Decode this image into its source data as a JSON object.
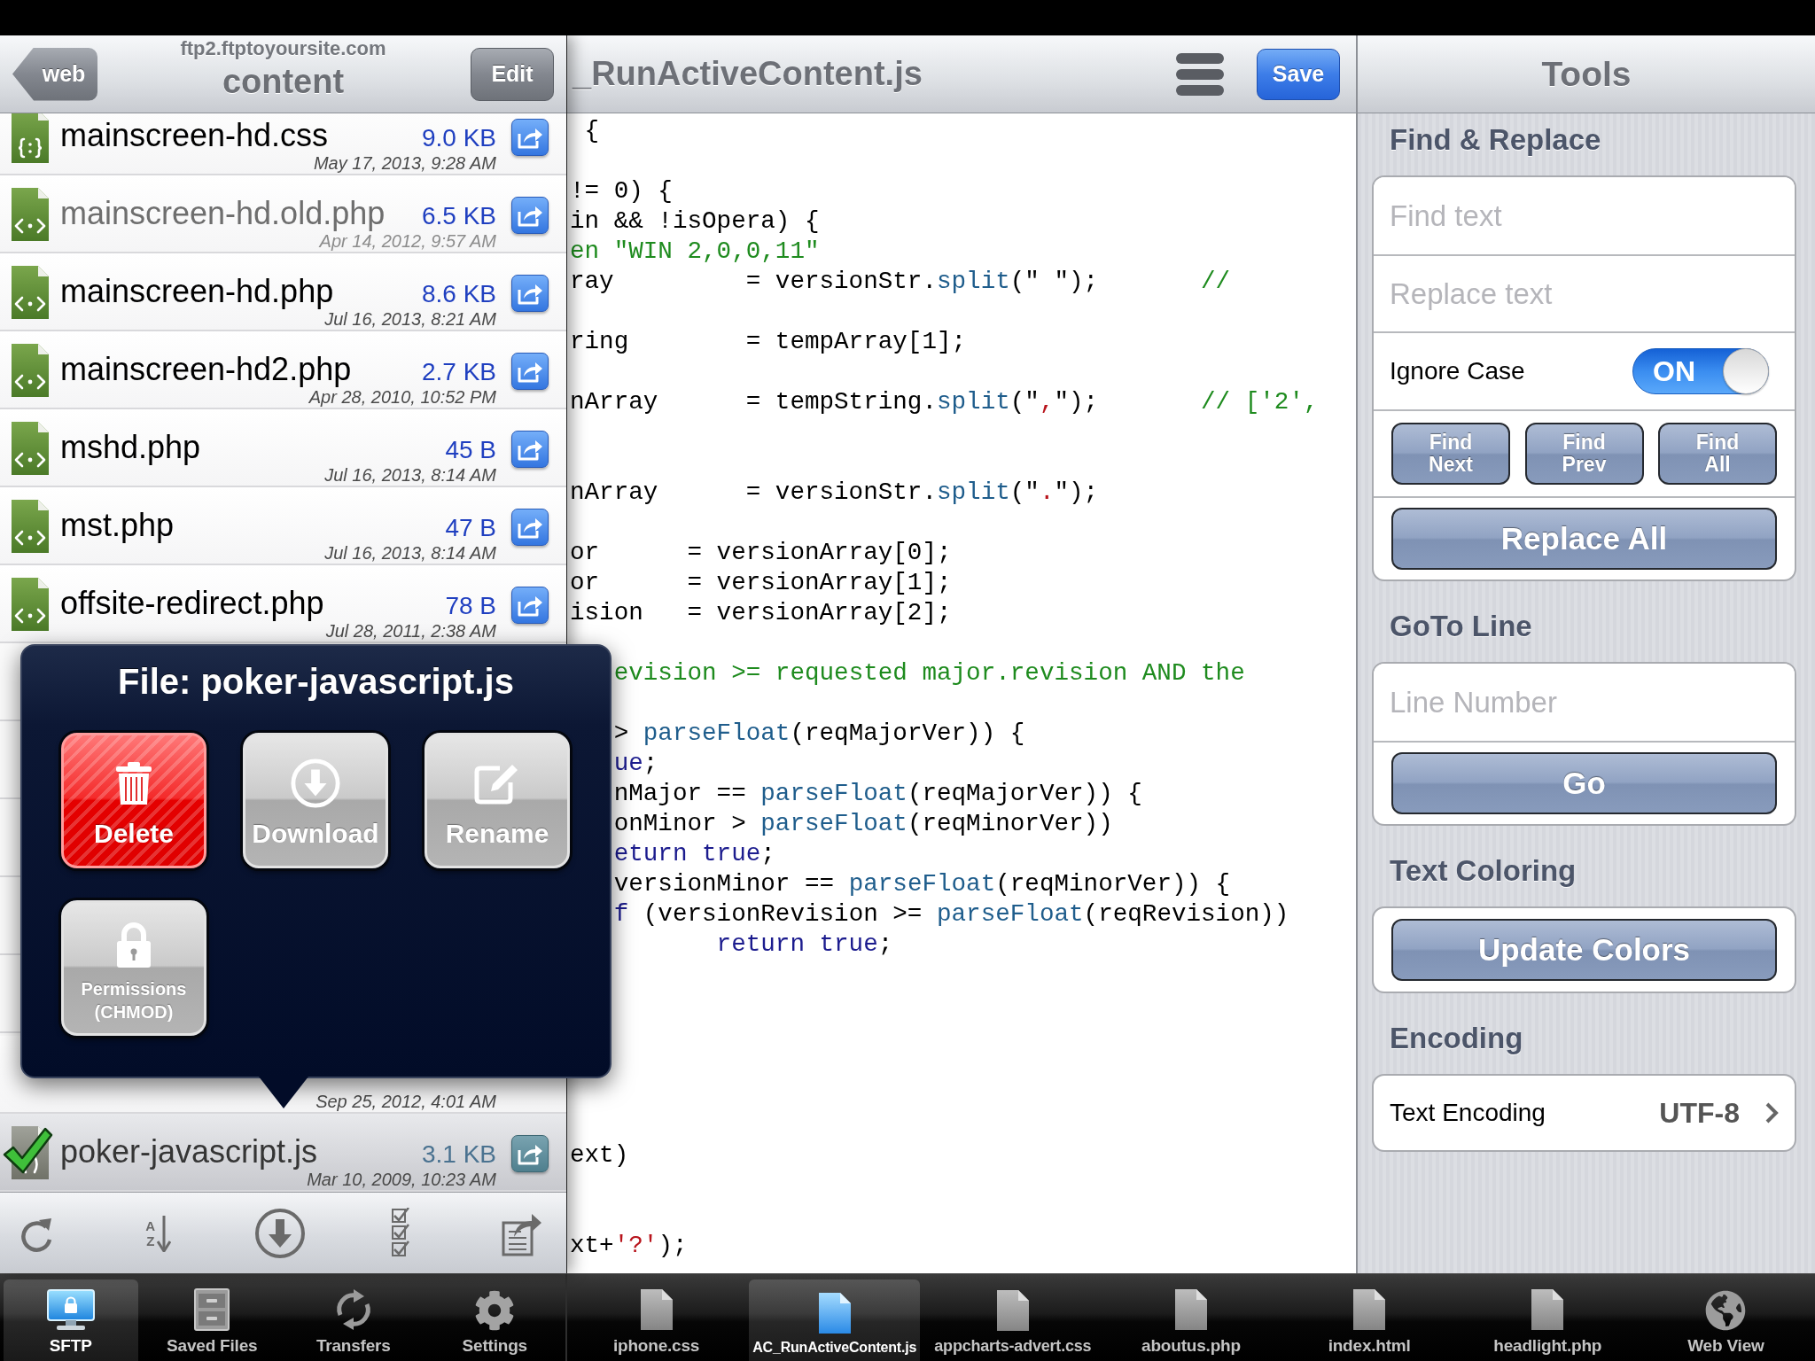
{
  "file_browser": {
    "back_button": "web",
    "host": "ftp2.ftptoyoursite.com",
    "title": "content",
    "edit_button": "Edit",
    "files": [
      {
        "name": "mainscreen-hd.css",
        "size": "9.0 KB",
        "date": "May 17, 2013, 9:28 AM",
        "kind": "css",
        "dimmed": false,
        "selected": false
      },
      {
        "name": "mainscreen-hd.old.php",
        "size": "6.5 KB",
        "date": "Apr 14, 2012, 9:57 AM",
        "kind": "php",
        "dimmed": true,
        "selected": false
      },
      {
        "name": "mainscreen-hd.php",
        "size": "8.6 KB",
        "date": "Jul 16, 2013, 8:21 AM",
        "kind": "php",
        "dimmed": false,
        "selected": false
      },
      {
        "name": "mainscreen-hd2.php",
        "size": "2.7 KB",
        "date": "Apr 28, 2010, 10:52 PM",
        "kind": "php",
        "dimmed": false,
        "selected": false
      },
      {
        "name": "mshd.php",
        "size": "45 B",
        "date": "Jul 16, 2013, 8:14 AM",
        "kind": "php",
        "dimmed": false,
        "selected": false
      },
      {
        "name": "mst.php",
        "size": "47 B",
        "date": "Jul 16, 2013, 8:14 AM",
        "kind": "php",
        "dimmed": false,
        "selected": false
      },
      {
        "name": "offsite-redirect.php",
        "size": "78 B",
        "date": "Jul 28, 2011, 2:38 AM",
        "kind": "php",
        "dimmed": false,
        "selected": false
      }
    ],
    "files_below_popover": [
      {
        "date": "Sep 25, 2012, 4:01 AM",
        "dimmed": false,
        "selected": false
      },
      {
        "name": "poker-javascript.js",
        "size": "3.1 KB",
        "date": "Mar 10, 2009, 10:23 AM",
        "kind": "js",
        "dimmed": false,
        "selected": true
      }
    ],
    "toolbar": [
      {
        "kind": "refresh"
      },
      {
        "kind": "sort",
        "glyphs": [
          "A",
          "Z"
        ]
      },
      {
        "kind": "download"
      },
      {
        "kind": "checklist"
      },
      {
        "kind": "export"
      }
    ]
  },
  "popover": {
    "title": "File: poker-javascript.js",
    "actions": [
      {
        "label": "Delete",
        "kind": "delete"
      },
      {
        "label": "Download",
        "kind": "download"
      },
      {
        "label": "Rename",
        "kind": "rename"
      },
      {
        "label": "Permissions (CHMOD)",
        "kind": "permissions"
      }
    ]
  },
  "editor": {
    "title": "_RunActiveContent.js",
    "save_button": "Save",
    "lines": [
      {
        "kind": "code",
        "segments": [
          {
            "text": " {",
            "kind": "plain"
          }
        ]
      },
      {
        "kind": "blank"
      },
      {
        "kind": "code",
        "segments": [
          {
            "text": "!= 0) {",
            "kind": "plain"
          }
        ]
      },
      {
        "kind": "code",
        "segments": [
          {
            "text": "in && !isOpera) {",
            "kind": "plain"
          }
        ]
      },
      {
        "kind": "code",
        "segments": [
          {
            "text": "en \"WIN 2,0,0,11\"",
            "kind": "comment"
          }
        ]
      },
      {
        "kind": "code",
        "segments": [
          {
            "text": "ray         = versionStr.",
            "kind": "plain"
          },
          {
            "text": "split",
            "kind": "function"
          },
          {
            "text": "(\" \");       ",
            "kind": "plain"
          },
          {
            "text": "//",
            "kind": "comment"
          }
        ]
      },
      {
        "kind": "blank"
      },
      {
        "kind": "code",
        "segments": [
          {
            "text": "ring        = tempArray[1];",
            "kind": "plain"
          }
        ]
      },
      {
        "kind": "blank"
      },
      {
        "kind": "code",
        "segments": [
          {
            "text": "nArray      = tempString.",
            "kind": "plain"
          },
          {
            "text": "split",
            "kind": "function"
          },
          {
            "text": "(\"",
            "kind": "plain"
          },
          {
            "text": ",",
            "kind": "string"
          },
          {
            "text": "\");       ",
            "kind": "plain"
          },
          {
            "text": "// ['2',",
            "kind": "comment"
          }
        ]
      },
      {
        "kind": "blank"
      },
      {
        "kind": "blank"
      },
      {
        "kind": "code",
        "segments": [
          {
            "text": "nArray      = versionStr.",
            "kind": "plain"
          },
          {
            "text": "split",
            "kind": "function"
          },
          {
            "text": "(\"",
            "kind": "plain"
          },
          {
            "text": ".",
            "kind": "string"
          },
          {
            "text": "\");",
            "kind": "plain"
          }
        ]
      },
      {
        "kind": "blank"
      },
      {
        "kind": "code",
        "segments": [
          {
            "text": "or      = versionArray[0];",
            "kind": "plain"
          }
        ]
      },
      {
        "kind": "code",
        "segments": [
          {
            "text": "or      = versionArray[1];",
            "kind": "plain"
          }
        ]
      },
      {
        "kind": "code",
        "segments": [
          {
            "text": "ision   = versionArray[2];",
            "kind": "plain"
          }
        ]
      },
      {
        "kind": "blank"
      },
      {
        "kind": "code",
        "segments": [
          {
            "text": "   evision >= requested major.revision AND the",
            "kind": "comment"
          }
        ]
      },
      {
        "kind": "blank"
      },
      {
        "kind": "code",
        "segments": [
          {
            "text": "   > ",
            "kind": "plain"
          },
          {
            "text": "parseFloat",
            "kind": "function"
          },
          {
            "text": "(reqMajorVer)) {",
            "kind": "plain"
          }
        ]
      },
      {
        "kind": "code",
        "segments": [
          {
            "text": "   ue",
            "kind": "keyword"
          },
          {
            "text": ";",
            "kind": "plain"
          }
        ]
      },
      {
        "kind": "code",
        "segments": [
          {
            "text": "   nMajor == ",
            "kind": "plain"
          },
          {
            "text": "parseFloat",
            "kind": "function"
          },
          {
            "text": "(reqMajorVer)) {",
            "kind": "plain"
          }
        ]
      },
      {
        "kind": "code",
        "segments": [
          {
            "text": "   onMinor > ",
            "kind": "plain"
          },
          {
            "text": "parseFloat",
            "kind": "function"
          },
          {
            "text": "(reqMinorVer))",
            "kind": "plain"
          }
        ]
      },
      {
        "kind": "code",
        "segments": [
          {
            "text": "   eturn true",
            "kind": "keyword"
          },
          {
            "text": ";",
            "kind": "plain"
          }
        ]
      },
      {
        "kind": "code",
        "segments": [
          {
            "text": "   versionMinor == ",
            "kind": "plain"
          },
          {
            "text": "parseFloat",
            "kind": "function"
          },
          {
            "text": "(reqMinorVer)) {",
            "kind": "plain"
          }
        ]
      },
      {
        "kind": "code",
        "segments": [
          {
            "text": "   f",
            "kind": "keyword"
          },
          {
            "text": " (versionRevision >= ",
            "kind": "plain"
          },
          {
            "text": "parseFloat",
            "kind": "function"
          },
          {
            "text": "(reqRevision))",
            "kind": "plain"
          }
        ]
      },
      {
        "kind": "code",
        "segments": [
          {
            "text": "          return true",
            "kind": "keyword"
          },
          {
            "text": ";",
            "kind": "plain"
          }
        ]
      },
      {
        "kind": "blank"
      },
      {
        "kind": "blank"
      },
      {
        "kind": "blank"
      },
      {
        "kind": "blank"
      },
      {
        "kind": "blank"
      },
      {
        "kind": "blank"
      },
      {
        "kind": "code",
        "segments": [
          {
            "text": "ext)",
            "kind": "plain"
          }
        ]
      },
      {
        "kind": "blank"
      },
      {
        "kind": "blank"
      },
      {
        "kind": "code",
        "segments": [
          {
            "text": "xt+",
            "kind": "plain"
          },
          {
            "text": "'?'",
            "kind": "string"
          },
          {
            "text": ");",
            "kind": "plain"
          }
        ]
      }
    ]
  },
  "tools": {
    "title": "Tools",
    "sections": [
      {
        "heading": "Find & Replace",
        "rows": [
          {
            "kind": "field",
            "placeholder": "Find text"
          },
          {
            "kind": "field",
            "placeholder": "Replace text"
          },
          {
            "kind": "switch",
            "label": "Ignore Case",
            "on": true,
            "state_text": "ON"
          },
          {
            "kind": "buttons",
            "buttons": [
              "Find Next",
              "Find Prev",
              "Find All"
            ]
          },
          {
            "kind": "button",
            "label": "Replace All"
          }
        ]
      },
      {
        "heading": "GoTo Line",
        "rows": [
          {
            "kind": "field",
            "placeholder": "Line Number"
          },
          {
            "kind": "button",
            "label": "Go"
          }
        ]
      },
      {
        "heading": "Text Coloring",
        "rows": [
          {
            "kind": "button",
            "label": "Update Colors"
          }
        ]
      },
      {
        "heading": "Encoding",
        "rows": [
          {
            "kind": "disclosure",
            "label": "Text Encoding",
            "value": "UTF-8"
          }
        ]
      }
    ]
  },
  "tab_bar": {
    "sections": [
      {
        "label": "SFTP",
        "kind": "sftp",
        "selected": true
      },
      {
        "label": "Saved Files",
        "kind": "cabinet",
        "selected": false
      },
      {
        "label": "Transfers",
        "kind": "transfers",
        "selected": false
      },
      {
        "label": "Settings",
        "kind": "settings",
        "selected": false
      }
    ],
    "documents": [
      {
        "label": "iphone.css",
        "kind": "document",
        "selected": false
      },
      {
        "label": "AC_RunActiveContent.js",
        "kind": "document",
        "selected": true
      },
      {
        "label": "appcharts-advert.css",
        "kind": "document",
        "selected": false
      },
      {
        "label": "aboutus.php",
        "kind": "document",
        "selected": false
      },
      {
        "label": "index.html",
        "kind": "document",
        "selected": false
      },
      {
        "label": "headlight.php",
        "kind": "document",
        "selected": false
      },
      {
        "label": "Web View",
        "kind": "web",
        "selected": false
      }
    ]
  }
}
